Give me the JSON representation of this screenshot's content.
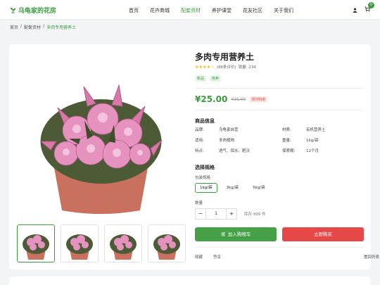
{
  "header": {
    "logo": "乌龟家的花房",
    "nav": [
      {
        "label": "首页",
        "active": false
      },
      {
        "label": "花卉商城",
        "active": false
      },
      {
        "label": "配套资材",
        "active": true
      },
      {
        "label": "养护课堂",
        "active": false
      },
      {
        "label": "花友社区",
        "active": false
      },
      {
        "label": "关于我们",
        "active": false
      }
    ],
    "cart_count": "0",
    "user_icon": "user-icon",
    "cart_icon": "cart-icon"
  },
  "breadcrumb": {
    "items": [
      "首页",
      "配套资材",
      "多肉专用营养土"
    ],
    "sep": "/"
  },
  "product": {
    "title": "多肉专用营养土",
    "rating_value": 4.5,
    "stars": "★★★★☆",
    "reviews": "(86条评价)",
    "sales": "销量: 234",
    "tags": [
      "新品",
      "热卖"
    ],
    "price": "¥25.00",
    "old_price": "¥35.00",
    "promo": "限时特惠",
    "info_heading": "商品信息",
    "info": [
      {
        "k1": "品牌:",
        "v1": "乌龟家自营",
        "k2": "材质:",
        "v2": "有机营养土"
      },
      {
        "k1": "适用:",
        "v1": "多肉植物",
        "k2": "重量:",
        "v2": "1kg/袋"
      },
      {
        "k1": "特点:",
        "v1": "透气、保水、肥沃",
        "k2": "保质期:",
        "v2": "12个月"
      }
    ],
    "spec_heading": "选择规格",
    "spec_label": "包装规格",
    "spec_options": [
      {
        "label": "1kg/袋",
        "selected": true
      },
      {
        "label": "3kg/袋",
        "selected": false
      },
      {
        "label": "5kg/袋",
        "selected": false
      }
    ],
    "qty_label": "数量",
    "qty_minus": "−",
    "qty_value": "1",
    "qty_plus": "+",
    "stock": "库存 999 件",
    "add_to_cart": "加入购物车",
    "buy_now": "立即购买",
    "favorite": "收藏",
    "share": "分享",
    "back": "返回列表",
    "colors": {
      "accent": "#46a047",
      "buy": "#e64747"
    }
  }
}
